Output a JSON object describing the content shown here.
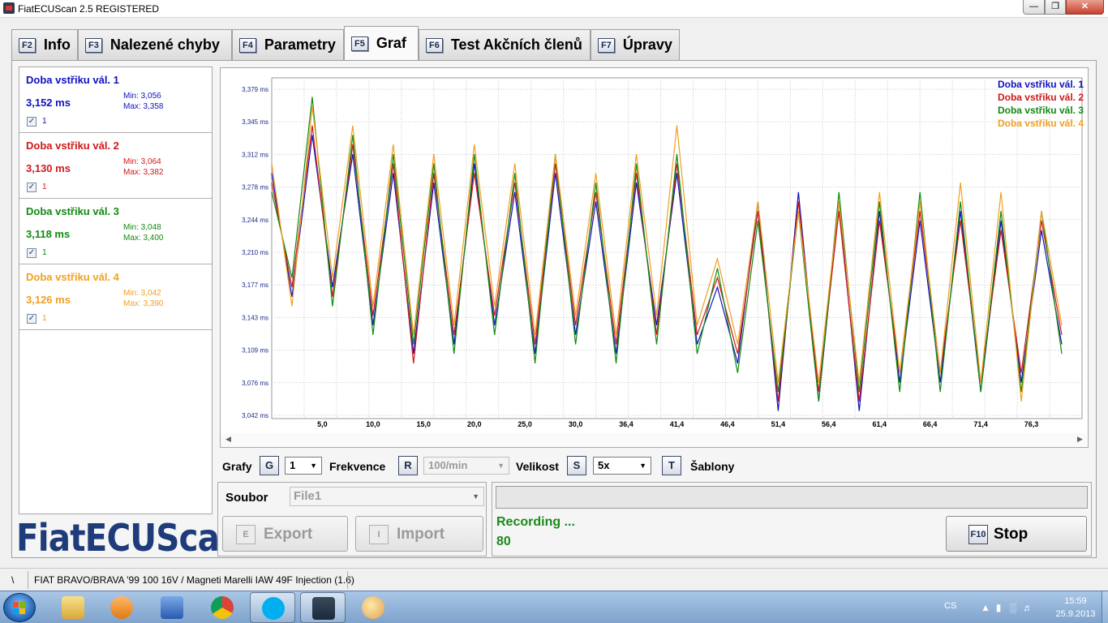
{
  "window": {
    "title": "FiatECUScan 2.5 REGISTERED",
    "minimize_icon": "minimize-icon",
    "maximize_icon": "maximize-icon",
    "close_icon": "close-icon"
  },
  "tabs": [
    {
      "key": "F2",
      "label": "Info",
      "active": false
    },
    {
      "key": "F3",
      "label": "Nalezené chyby",
      "active": false
    },
    {
      "key": "F4",
      "label": "Parametry",
      "active": false
    },
    {
      "key": "F5",
      "label": "Graf",
      "active": true
    },
    {
      "key": "F6",
      "label": "Test Akčních členů",
      "active": false
    },
    {
      "key": "F7",
      "label": "Úpravy",
      "active": false
    }
  ],
  "sensors": [
    {
      "name": "Doba vstřiku vál. 1",
      "value": "3,152 ms",
      "min": "Min: 3,056",
      "max": "Max: 3,358",
      "checkbox_label": "1",
      "checked": true,
      "color": "#1010c0"
    },
    {
      "name": "Doba vstřiku vál. 2",
      "value": "3,130 ms",
      "min": "Min: 3,064",
      "max": "Max: 3,382",
      "checkbox_label": "1",
      "checked": true,
      "color": "#d01818"
    },
    {
      "name": "Doba vstřiku vál. 3",
      "value": "3,118 ms",
      "min": "Min: 3,048",
      "max": "Max: 3,400",
      "checkbox_label": "1",
      "checked": true,
      "color": "#108a10"
    },
    {
      "name": "Doba vstřiku vál. 4",
      "value": "3,126 ms",
      "min": "Min: 3,042",
      "max": "Max: 3,390",
      "checkbox_label": "1",
      "checked": true,
      "color": "#f0a020"
    }
  ],
  "logo": "FiatECUScan",
  "chart_data": {
    "type": "line",
    "title": "",
    "xlabel": "",
    "ylabel": "",
    "y_ticks": [
      "3,042 ms",
      "3,076 ms",
      "3,109 ms",
      "3,143 ms",
      "3,177 ms",
      "3,210 ms",
      "3,244 ms",
      "3,278 ms",
      "3,312 ms",
      "3,345 ms",
      "3,379 ms"
    ],
    "x_ticks": [
      "5,0",
      "10,0",
      "15,0",
      "20,0",
      "25,0",
      "30,0",
      "36,4",
      "41,4",
      "46,4",
      "51,4",
      "56,4",
      "61,4",
      "66,4",
      "71,4",
      "76,3"
    ],
    "ylim": [
      3.042,
      3.4
    ],
    "xlim": [
      0,
      80
    ],
    "grid": true,
    "legend_position": "top-right",
    "series": [
      {
        "name": "Doba vstřiku vál. 1",
        "color": "#1010c0",
        "x": [
          0,
          2,
          4,
          6,
          8,
          10,
          12,
          14,
          16,
          18,
          20,
          22,
          24,
          26,
          28,
          30,
          32,
          34,
          36,
          38,
          40,
          42,
          44,
          46,
          48,
          50,
          52,
          54,
          56,
          58,
          60,
          62,
          64,
          66,
          68,
          70,
          72,
          74,
          76,
          78
        ],
        "values": [
          3.3,
          3.17,
          3.34,
          3.18,
          3.32,
          3.14,
          3.3,
          3.11,
          3.29,
          3.12,
          3.31,
          3.14,
          3.28,
          3.11,
          3.3,
          3.13,
          3.27,
          3.11,
          3.29,
          3.14,
          3.3,
          3.12,
          3.18,
          3.1,
          3.27,
          3.05,
          3.28,
          3.06,
          3.27,
          3.05,
          3.26,
          3.08,
          3.25,
          3.08,
          3.26,
          3.07,
          3.25,
          3.08,
          3.24,
          3.12
        ]
      },
      {
        "name": "Doba vstřiku vál. 2",
        "color": "#d01818",
        "x": [
          0,
          2,
          4,
          6,
          8,
          10,
          12,
          14,
          16,
          18,
          20,
          22,
          24,
          26,
          28,
          30,
          32,
          34,
          36,
          38,
          40,
          42,
          44,
          46,
          48,
          50,
          52,
          54,
          56,
          58,
          60,
          62,
          64,
          66,
          68,
          70,
          72,
          74,
          76,
          78
        ],
        "values": [
          3.29,
          3.18,
          3.35,
          3.17,
          3.33,
          3.15,
          3.31,
          3.1,
          3.3,
          3.13,
          3.3,
          3.15,
          3.29,
          3.12,
          3.31,
          3.14,
          3.28,
          3.12,
          3.3,
          3.13,
          3.31,
          3.13,
          3.19,
          3.11,
          3.26,
          3.06,
          3.27,
          3.07,
          3.26,
          3.06,
          3.25,
          3.09,
          3.26,
          3.09,
          3.25,
          3.08,
          3.24,
          3.09,
          3.25,
          3.13
        ]
      },
      {
        "name": "Doba vstřiku vál. 3",
        "color": "#108a10",
        "x": [
          0,
          2,
          4,
          6,
          8,
          10,
          12,
          14,
          16,
          18,
          20,
          22,
          24,
          26,
          28,
          30,
          32,
          34,
          36,
          38,
          40,
          42,
          44,
          46,
          48,
          50,
          52,
          54,
          56,
          58,
          60,
          62,
          64,
          66,
          68,
          70,
          72,
          74,
          76,
          78
        ],
        "values": [
          3.28,
          3.19,
          3.38,
          3.16,
          3.34,
          3.13,
          3.32,
          3.12,
          3.31,
          3.11,
          3.32,
          3.13,
          3.3,
          3.1,
          3.32,
          3.12,
          3.29,
          3.1,
          3.31,
          3.12,
          3.32,
          3.11,
          3.2,
          3.09,
          3.25,
          3.07,
          3.26,
          3.06,
          3.28,
          3.07,
          3.27,
          3.07,
          3.28,
          3.07,
          3.27,
          3.07,
          3.26,
          3.07,
          3.26,
          3.11
        ]
      },
      {
        "name": "Doba vstřiku vál. 4",
        "color": "#f0a020",
        "x": [
          0,
          2,
          4,
          6,
          8,
          10,
          12,
          14,
          16,
          18,
          20,
          22,
          24,
          26,
          28,
          30,
          32,
          34,
          36,
          38,
          40,
          42,
          44,
          46,
          48,
          50,
          52,
          54,
          56,
          58,
          60,
          62,
          64,
          66,
          68,
          70,
          72,
          74,
          76,
          78
        ],
        "values": [
          3.31,
          3.16,
          3.37,
          3.19,
          3.35,
          3.16,
          3.33,
          3.13,
          3.32,
          3.14,
          3.33,
          3.16,
          3.31,
          3.13,
          3.32,
          3.15,
          3.3,
          3.13,
          3.32,
          3.15,
          3.35,
          3.14,
          3.21,
          3.12,
          3.27,
          3.08,
          3.26,
          3.08,
          3.27,
          3.08,
          3.28,
          3.09,
          3.27,
          3.09,
          3.29,
          3.08,
          3.28,
          3.06,
          3.26,
          3.14
        ]
      }
    ]
  },
  "controls": {
    "grafy_label": "Grafy",
    "grafy_key": "G",
    "grafy_value": "1",
    "frekvence_label": "Frekvence",
    "frekvence_key": "R",
    "frekvence_value": "100/min",
    "velikost_label": "Velikost",
    "velikost_key": "S",
    "velikost_value": "5x",
    "sablony_key": "T",
    "sablony_label": "Šablony"
  },
  "file": {
    "label": "Soubor",
    "value": "File1",
    "export_key": "E",
    "export_label": "Export",
    "import_key": "I",
    "import_label": "Import"
  },
  "recording": {
    "status": "Recording ...",
    "count": "80",
    "stop_key": "F10",
    "stop_label": "Stop"
  },
  "statusbar": {
    "left": "\\",
    "vehicle": "FIAT BRAVO/BRAVA '99 100 16V / Magneti Marelli IAW 49F Injection (1.6)"
  },
  "taskbar": {
    "apps": [
      "explorer-icon",
      "media-player-icon",
      "app-icon",
      "chrome-icon",
      "skype-icon",
      "fiatecuscan-icon",
      "paint-icon"
    ],
    "language": "CS",
    "time": "15:59",
    "date": "25.9.2013"
  }
}
